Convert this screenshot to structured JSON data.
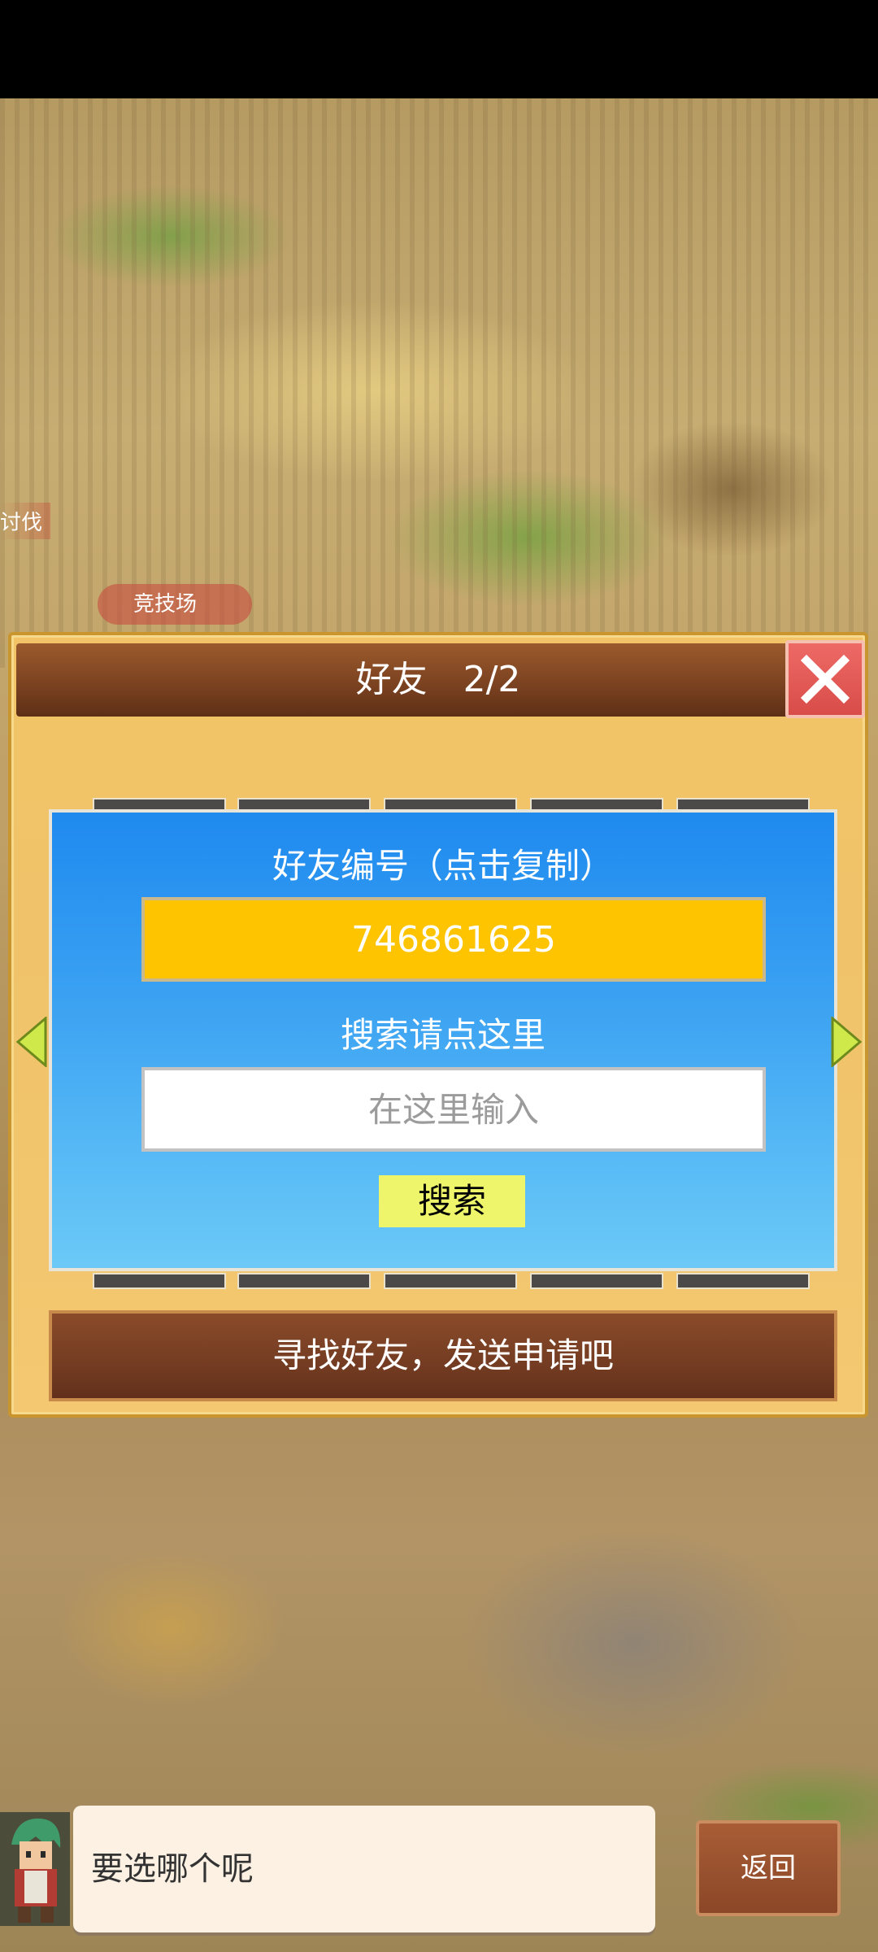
{
  "map_labels": {
    "taofa": "讨伐",
    "arena": "竞技场"
  },
  "dialog": {
    "title": "好友",
    "count": "2/2",
    "close_icon": "close-x-icon"
  },
  "friend_panel": {
    "id_heading": "好友编号（点击复制）",
    "friend_id": "746861625",
    "search_heading": "搜索请点这里",
    "search_placeholder": "在这里输入",
    "search_button": "搜索"
  },
  "find_bar_text": "寻找好友，发送申请吧",
  "chat": {
    "message": "要选哪个呢",
    "back_button": "返回"
  },
  "colors": {
    "id_box": "#ffc400",
    "panel_top": "#1f8aef",
    "panel_bottom": "#6cc9f7",
    "close_button": "#e05a57",
    "search_button": "#eef56a"
  }
}
